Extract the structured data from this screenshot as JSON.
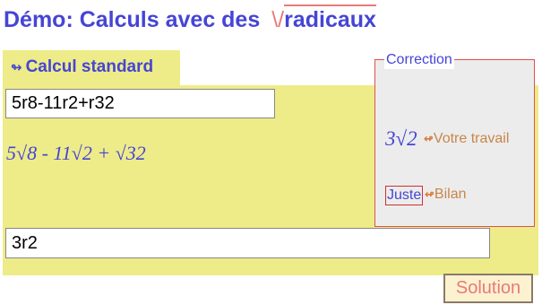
{
  "header": {
    "title_text": "Démo: Calculs avec des",
    "radical_symbol": "\\/",
    "radical_word": "radicaux"
  },
  "tab": {
    "arrow_icon": "↬",
    "label": "Calcul standard"
  },
  "exercise": {
    "input_value": "5r8-11r2+r32",
    "expression_display": "5√8 - 11√2 + √32"
  },
  "answer": {
    "input_value": "3r2"
  },
  "correction": {
    "legend": "Correction",
    "result_display": "3√2",
    "result_arrow": "↫",
    "result_label": "Votre travail",
    "verdict": "Juste",
    "verdict_arrow": "↫",
    "verdict_label": "Bilan"
  },
  "buttons": {
    "solution_label": "Solution"
  },
  "colors": {
    "accent_blue": "#4545d6",
    "panel_yellow": "#eeec88",
    "radical_red": "#e87a7a",
    "label_orange": "#c8864a"
  }
}
